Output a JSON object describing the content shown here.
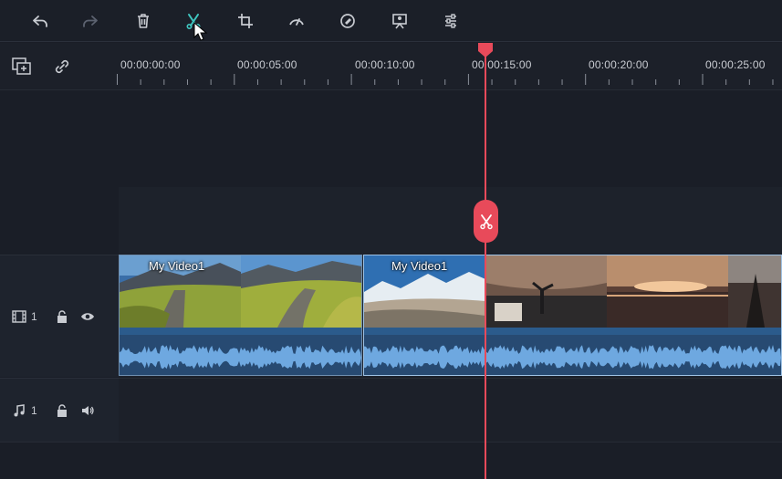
{
  "toolbar": {
    "buttons": [
      {
        "name": "undo-icon"
      },
      {
        "name": "redo-icon"
      },
      {
        "name": "delete-icon"
      },
      {
        "name": "split-scissors-icon"
      },
      {
        "name": "crop-icon"
      },
      {
        "name": "speed-icon"
      },
      {
        "name": "color-icon"
      },
      {
        "name": "green-screen-icon"
      },
      {
        "name": "adjust-icon"
      }
    ]
  },
  "ruler": {
    "tools": [
      {
        "name": "add-track-icon"
      },
      {
        "name": "link-icon"
      }
    ],
    "times": [
      "00:00:00:00",
      "00:00:05:00",
      "00:00:10:00",
      "00:00:15:00",
      "00:00:20:00",
      "00:00:25:00"
    ]
  },
  "tracks": {
    "video": {
      "number": "1"
    },
    "audio": {
      "number": "1"
    }
  },
  "clips": [
    {
      "label": "My Video1"
    },
    {
      "label": "My Video1"
    }
  ],
  "colors": {
    "accent": "#e84a5a",
    "waveform": "#6ea8e0",
    "clip_selected_border": "#9ec2e4",
    "background": "#1a1e27"
  }
}
